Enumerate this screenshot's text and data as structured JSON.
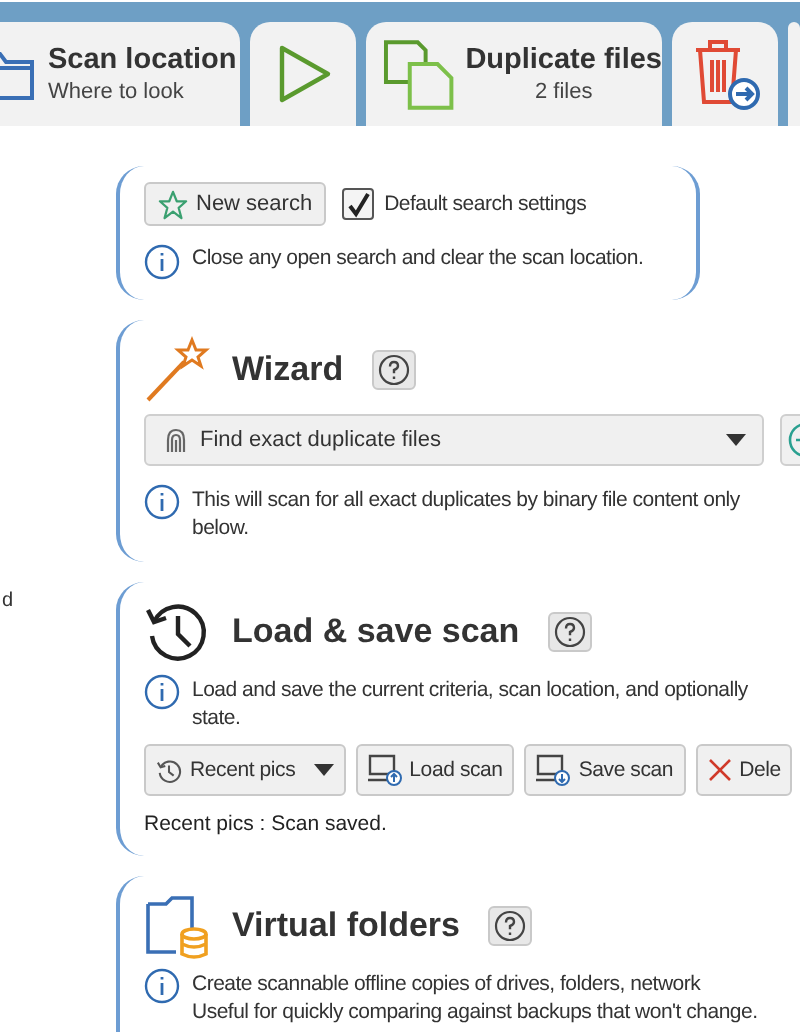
{
  "tabs": [
    {
      "kind": "location",
      "title": "Scan location",
      "subtitle": "Where to look"
    },
    {
      "kind": "play"
    },
    {
      "kind": "duplicates",
      "title": "Duplicate files",
      "subtitle": "2 files"
    },
    {
      "kind": "trash"
    },
    {
      "kind": "blank"
    }
  ],
  "side_text": "d",
  "new_search": {
    "button": "New search",
    "checkbox": {
      "label": "Default search settings",
      "checked": true
    },
    "info": "Close any open search and clear the scan location."
  },
  "wizard": {
    "title": "Wizard",
    "dropdown": "Find exact duplicate files",
    "info_lines": [
      "This will scan for all exact duplicates by binary file content only",
      "below."
    ]
  },
  "load_save": {
    "title": "Load & save scan",
    "info_lines": [
      "Load and save the current criteria, scan location, and optionally",
      "state."
    ],
    "recent_button": "Recent pics",
    "buttons": [
      {
        "kind": "load",
        "label": "Load scan"
      },
      {
        "kind": "save",
        "label": "Save scan"
      },
      {
        "kind": "delete",
        "label": "Dele"
      }
    ],
    "status": "Recent pics : Scan saved."
  },
  "virtual_folders": {
    "title": "Virtual folders",
    "info_lines": [
      "Create scannable offline copies of drives, folders, network",
      "Useful for quickly comparing against backups that won't change."
    ]
  }
}
